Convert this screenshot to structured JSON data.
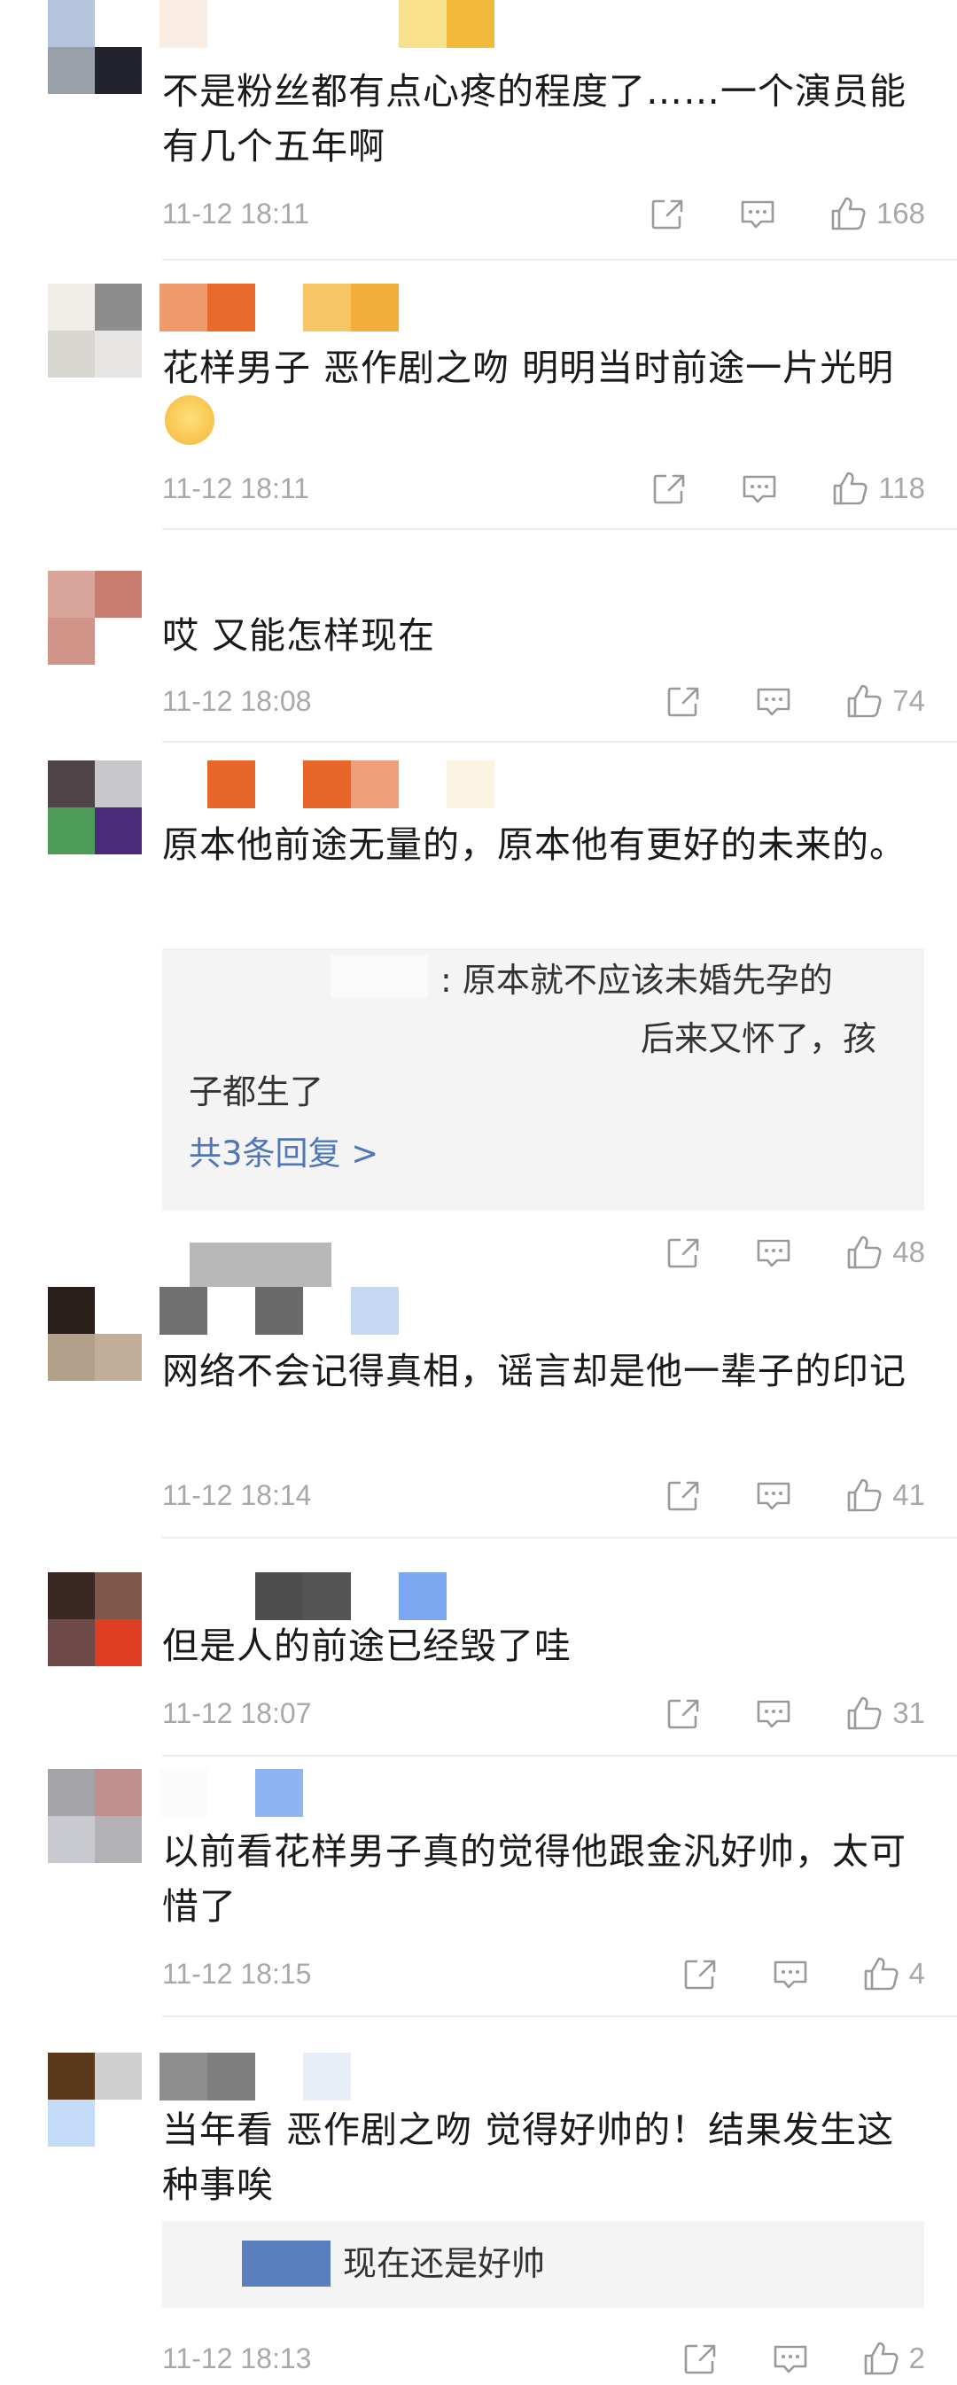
{
  "colors": {
    "timestamp": "#a8a8a8",
    "link": "#4f76b8",
    "reply_bg": "#f4f4f4",
    "divider": "#ededed"
  },
  "icons": [
    "share-icon",
    "comment-icon",
    "like-icon",
    "crying-emoji-icon"
  ],
  "comments": [
    {
      "text": "不是粉丝都有点心疼的程度了……一个演员能有几个五年啊",
      "time": "11-12 18:11",
      "likes": "168"
    },
    {
      "text": "花样男子 恶作剧之吻 明明当时前途一片光明",
      "time": "11-12 18:11",
      "likes": "118"
    },
    {
      "text": "哎 又能怎样现在",
      "time": "11-12 18:08",
      "likes": "74"
    },
    {
      "text": "原本他前途无量的，原本他有更好的未来的。",
      "time": "",
      "likes": "48",
      "reply": {
        "line1": ": 原本就不应该未婚先孕的",
        "line2": "后来又怀了，孩",
        "line3": "子都生了",
        "more": "共3条回复 >"
      }
    },
    {
      "text": "网络不会记得真相，谣言却是他一辈子的印记",
      "time": "11-12 18:14",
      "likes": "41"
    },
    {
      "text": "但是人的前途已经毁了哇",
      "time": "11-12 18:07",
      "likes": "31"
    },
    {
      "text": "以前看花样男子真的觉得他跟金汎好帅，太可惜了",
      "time": "11-12 18:15",
      "likes": "4"
    },
    {
      "text": "当年看 恶作剧之吻 觉得好帅的！结果发生这种事唉",
      "time": "11-12 18:13",
      "likes": "2",
      "reply": {
        "line1": "现在还是好帅"
      }
    }
  ]
}
